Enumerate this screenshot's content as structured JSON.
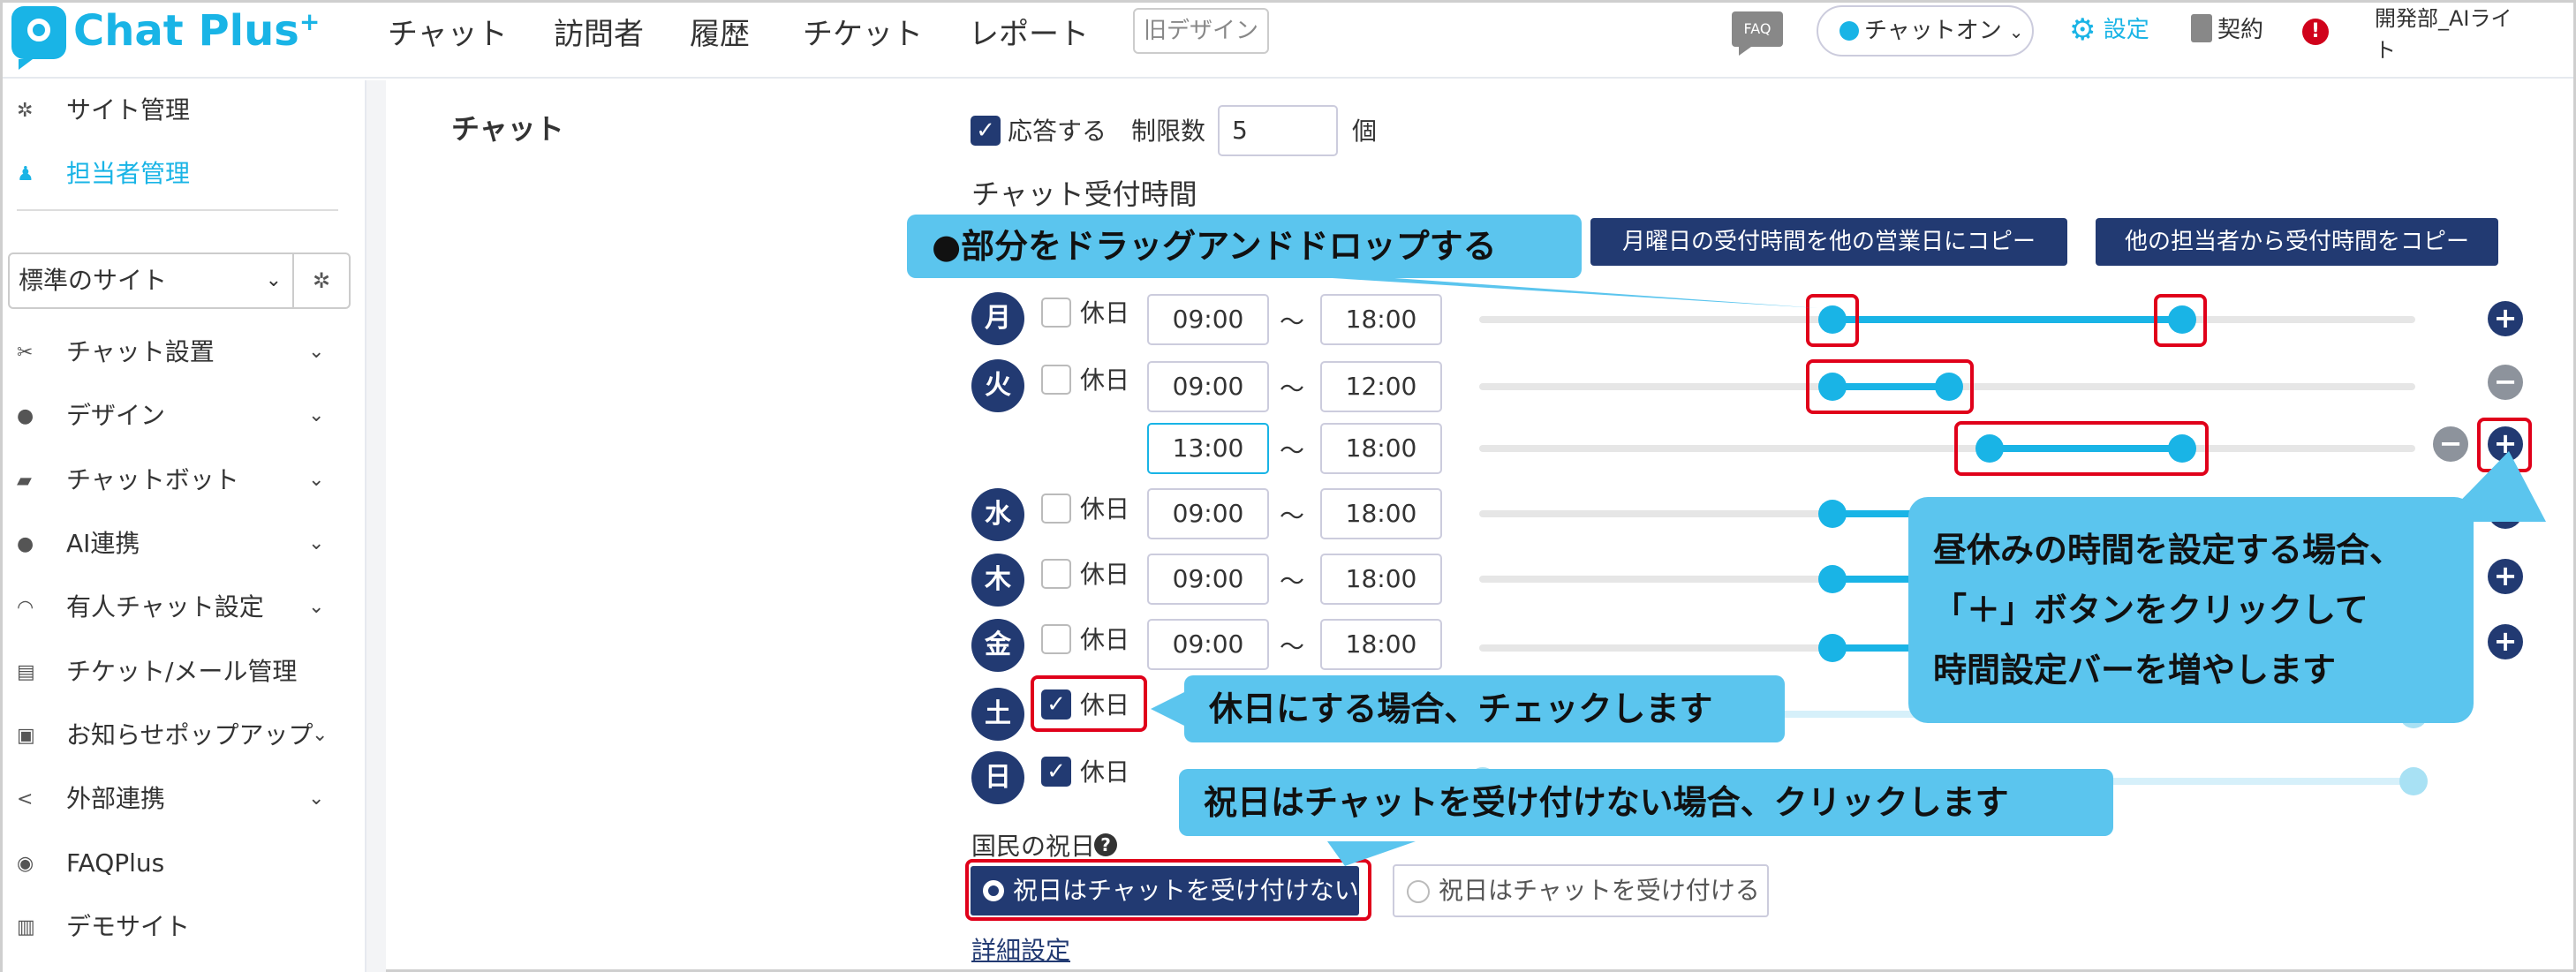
{
  "header": {
    "logo_text": "Chat Plus",
    "logo_sup": "+",
    "nav": [
      "チャット",
      "訪問者",
      "履歴",
      "チケット",
      "レポート"
    ],
    "old_design": "旧デザイン",
    "faq": "FAQ",
    "chat_toggle": "チャットオン",
    "settings": "設定",
    "contract": "契約",
    "alert": "!",
    "account_line1": "開発部_AIライ",
    "account_line2": "ト"
  },
  "sidebar": {
    "top_items": [
      {
        "label": "サイト管理",
        "icon": "gear-icon"
      },
      {
        "label": "担当者管理",
        "icon": "users-icon",
        "active": true
      }
    ],
    "site_select": "標準のサイト",
    "items": [
      {
        "label": "チャット設置",
        "icon": "tools-icon"
      },
      {
        "label": "デザイン",
        "icon": "palette-icon"
      },
      {
        "label": "チャットボット",
        "icon": "chat-icon"
      },
      {
        "label": "AI連携",
        "icon": "ai-icon"
      },
      {
        "label": "有人チャット設定",
        "icon": "headset-icon"
      },
      {
        "label": "チケット/メール管理",
        "icon": "ticket-icon"
      },
      {
        "label": "お知らせポップアップ",
        "icon": "popup-icon"
      },
      {
        "label": "外部連携",
        "icon": "share-icon"
      },
      {
        "label": "FAQPlus",
        "icon": "faq-icon"
      },
      {
        "label": "デモサイト",
        "icon": "demo-icon"
      }
    ]
  },
  "main": {
    "section_title": "チャット",
    "respond_label": "応答する",
    "limit_label": "制限数",
    "limit_value": "5",
    "limit_unit": "個",
    "hours_title": "チャット受付時間",
    "copy_monday_button": "月曜日の受付時間を他の営業日にコピー",
    "copy_other_button": "他の担当者から受付時間をコピー",
    "holiday_text": "休日",
    "tilde": "～",
    "days": [
      {
        "day": "月",
        "start": "09:00",
        "end": "18:00"
      },
      {
        "day": "火",
        "start": "09:00",
        "end": "12:00",
        "start2": "13:00",
        "end2": "18:00"
      },
      {
        "day": "水",
        "start": "09:00",
        "end": "18:00"
      },
      {
        "day": "木",
        "start": "09:00",
        "end": "18:00"
      },
      {
        "day": "金",
        "start": "09:00",
        "end": "18:00"
      },
      {
        "day": "土",
        "holiday": true
      },
      {
        "day": "日",
        "holiday": true
      }
    ],
    "national_holiday_label": "国民の祝日",
    "holiday_option_no": "祝日はチャットを受け付けない",
    "holiday_option_yes": "祝日はチャットを受け付ける",
    "detail_link": "詳細設定"
  },
  "callouts": {
    "drag": "●部分をドラッグアンドドロップする",
    "lunch_line1": "昼休みの時間を設定する場合、",
    "lunch_line2": "「＋」ボタンをクリックして",
    "lunch_line3": "時間設定バーを増やします",
    "holiday_check": "休日にする場合、チェックします",
    "national_holiday": "祝日はチャットを受け付けない場合、クリックします"
  },
  "colors": {
    "accent": "#19b4e6",
    "navy": "#223a72",
    "callout": "#5bc5ee",
    "highlight": "#e0001a"
  }
}
